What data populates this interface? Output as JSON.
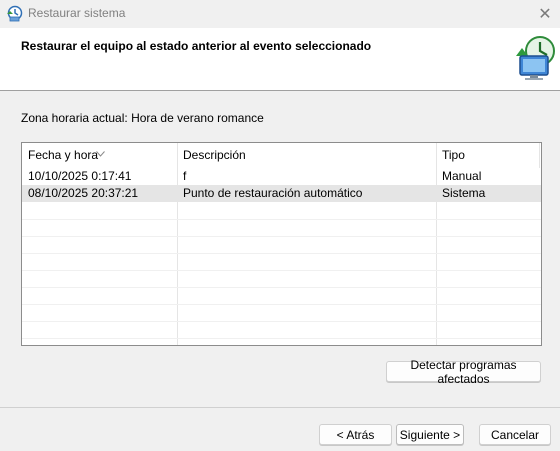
{
  "window": {
    "title": "Restaurar sistema",
    "close_glyph": "✕"
  },
  "header": {
    "title": "Restaurar el equipo al estado anterior al evento seleccionado",
    "icon": "system-restore-icon"
  },
  "timezone_label": "Zona horaria actual: Hora de verano romance",
  "table": {
    "columns": [
      "Fecha y hora",
      "Descripción",
      "Tipo"
    ],
    "sorted_column": "Fecha y hora",
    "rows": [
      {
        "date": "10/10/2025 0:17:41",
        "description": "f",
        "type": "Manual",
        "selected": false
      },
      {
        "date": "08/10/2025 20:37:21",
        "description": "Punto de restauración automático",
        "type": "Sistema",
        "selected": true
      }
    ]
  },
  "buttons": {
    "detect": "Detectar programas afectados",
    "back": "< Atrás",
    "next": "Siguiente >",
    "cancel": "Cancelar"
  },
  "colors": {
    "selection": "#e5e5e5",
    "header_bg": "#ffffff",
    "window_bg": "#f0f0f0"
  }
}
